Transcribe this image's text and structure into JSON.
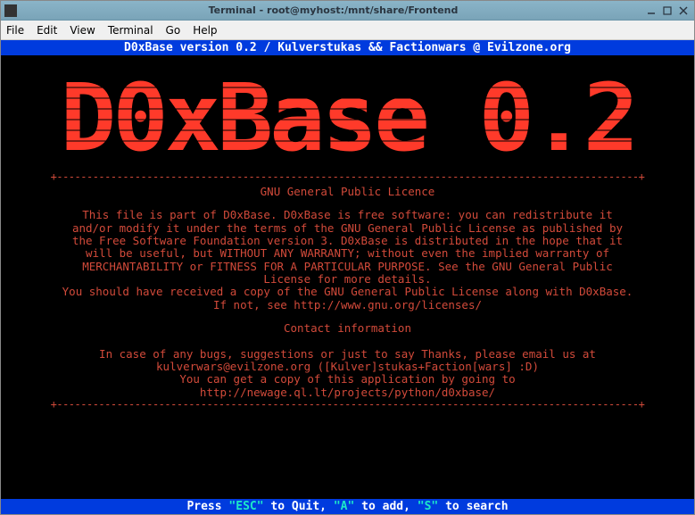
{
  "window": {
    "title": "Terminal - root@myhost:/mnt/share/Frontend"
  },
  "menubar": {
    "file": "File",
    "edit": "Edit",
    "view": "View",
    "terminal": "Terminal",
    "go": "Go",
    "help": "Help"
  },
  "header": {
    "text": "D0xBase version 0.2 / Kulverstukas && Factionwars @ Evilzone.org"
  },
  "logo": {
    "text": "D0xBase 0.2"
  },
  "divider": "+-------------------------------------------------------------------------------------------------+",
  "license": {
    "title": "GNU General Public Licence",
    "line1": "This file is part of D0xBase. D0xBase is free software: you can redistribute it",
    "line2": "and/or modify it under the terms of the GNU General Public License as published by",
    "line3": "the Free Software Foundation version 3. D0xBase is distributed in the hope that it",
    "line4": "will be useful, but WITHOUT ANY WARRANTY; without even the implied warranty of",
    "line5": "MERCHANTABILITY or FITNESS FOR A PARTICULAR PURPOSE. See the GNU General Public",
    "line6": "License for more details.",
    "line7": "You should have received a copy of the GNU General Public License along with D0xBase.",
    "line8": "If not, see http://www.gnu.org/licenses/"
  },
  "contact": {
    "title": "Contact information",
    "line1": "In case of any bugs, suggestions or just to say Thanks, please email us at",
    "line2": "kulverwars@evilzone.org ([Kulver]stukas+Faction[wars] :D)",
    "line3": "You can get a copy of this application by going to",
    "line4": "http://newage.ql.lt/projects/python/d0xbase/"
  },
  "footer": {
    "prefix": "Press ",
    "key1": "\"ESC\"",
    "mid1": " to Quit, ",
    "key2": "\"A\"",
    "mid2": " to add, ",
    "key3": "\"S\"",
    "suffix": " to search"
  }
}
